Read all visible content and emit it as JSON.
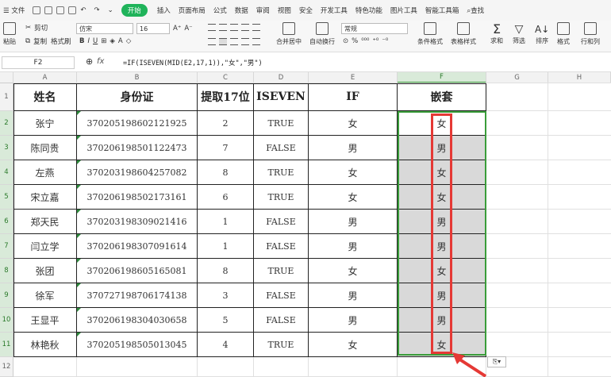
{
  "menu": {
    "file": "文件",
    "tabs": [
      "开始",
      "插入",
      "页面布局",
      "公式",
      "数据",
      "审阅",
      "视图",
      "安全",
      "开发工具",
      "特色功能",
      "图片工具",
      "智能工具箱"
    ],
    "search": "查找"
  },
  "ribbon": {
    "paste": "粘贴",
    "cut": "剪切",
    "copy": "复制",
    "format_painter": "格式刷",
    "font_name": "仿宋",
    "font_size": "16",
    "merge": "合并居中",
    "wrap": "自动换行",
    "number_format": "常规",
    "cond_format": "条件格式",
    "table_style": "表格样式",
    "sum": "求和",
    "filter": "筛选",
    "sort": "排序",
    "format": "格式",
    "rowcol": "行和列"
  },
  "formula_bar": {
    "name_box": "F2",
    "fx": "fx",
    "formula": "=IF(ISEVEN(MID(E2,17,1)),\"女\",\"男\")"
  },
  "columns": [
    "A",
    "B",
    "C",
    "D",
    "E",
    "F",
    "G",
    "H"
  ],
  "rows": [
    "1",
    "2",
    "3",
    "4",
    "5",
    "6",
    "7",
    "8",
    "9",
    "10",
    "11",
    "12"
  ],
  "headers": [
    "姓名",
    "身份证",
    "提取17位",
    "ISEVEN",
    "IF",
    "嵌套"
  ],
  "data": [
    {
      "name": "张宁",
      "id": "370205198602121925",
      "d17": "2",
      "even": "TRUE",
      "if": "女",
      "nest": "女"
    },
    {
      "name": "陈同贵",
      "id": "370206198501122473",
      "d17": "7",
      "even": "FALSE",
      "if": "男",
      "nest": "男"
    },
    {
      "name": "左燕",
      "id": "370203198604257082",
      "d17": "8",
      "even": "TRUE",
      "if": "女",
      "nest": "女"
    },
    {
      "name": "宋立嘉",
      "id": "370206198502173161",
      "d17": "6",
      "even": "TRUE",
      "if": "女",
      "nest": "女"
    },
    {
      "name": "郑天民",
      "id": "370203198309021416",
      "d17": "1",
      "even": "FALSE",
      "if": "男",
      "nest": "男"
    },
    {
      "name": "闫立学",
      "id": "370206198307091614",
      "d17": "1",
      "even": "FALSE",
      "if": "男",
      "nest": "男"
    },
    {
      "name": "张团",
      "id": "370206198605165081",
      "d17": "8",
      "even": "TRUE",
      "if": "女",
      "nest": "女"
    },
    {
      "name": "徐军",
      "id": "370727198706174138",
      "d17": "3",
      "even": "FALSE",
      "if": "男",
      "nest": "男"
    },
    {
      "name": "王显平",
      "id": "370206198304030658",
      "d17": "5",
      "even": "FALSE",
      "if": "男",
      "nest": "男"
    },
    {
      "name": "林艳秋",
      "id": "370205198505013045",
      "d17": "4",
      "even": "TRUE",
      "if": "女",
      "nest": "女"
    }
  ],
  "colors": {
    "accent": "#1fb35a",
    "selection": "#3a9d3a",
    "highlight": "#e53935"
  }
}
